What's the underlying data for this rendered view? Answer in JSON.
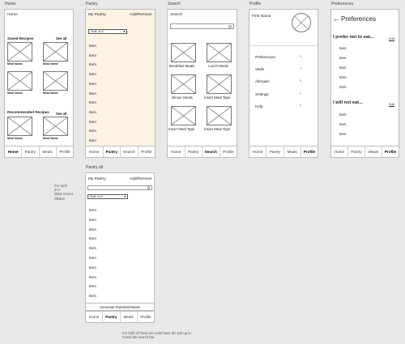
{
  "labels": {
    "home": "Home",
    "pantry": "Pantry",
    "search": "Search",
    "profile": "Profile",
    "preferences": "Preferences",
    "pantry_alt": "Pantry alt"
  },
  "tabs": [
    "Home",
    "Pantry",
    "Search",
    "Profile"
  ],
  "tabs_alt": [
    "Home",
    "Pantry",
    "Meals",
    "Profile"
  ],
  "home": {
    "title": "Home",
    "saved": "Saved Recipes",
    "see_all": "See all",
    "meal_name": "Meal Name",
    "recommended": "Recommended Recipes",
    "see_all_2": "See all"
  },
  "pantry": {
    "title": "My Pantry",
    "action": "Add/Remove",
    "sort": "Sort: A-Z",
    "item": "Item",
    "items_count": 11
  },
  "search": {
    "title": "Search",
    "meals": [
      "Breakfast Meals",
      "Lunch Meals",
      "Dinner Meals",
      "Insert Meal Type",
      "Insert Meal Type",
      "Insert Meal Type"
    ]
  },
  "profile": {
    "name": "First Name",
    "menu": [
      "Preferences",
      "Vedis",
      "Allergies",
      "Settings",
      "Help"
    ]
  },
  "prefs": {
    "title": "Preferences",
    "back": "←",
    "section1": "I prefer not to eat...",
    "section2": "I will not eat...",
    "edit": "Edit",
    "item": "Item"
  },
  "pantry_alt": {
    "title": "My Pantry",
    "action": "Add/Remove",
    "sort": "Sort: A-Z",
    "item": "Item",
    "generate": "Generate Potential Meals"
  },
  "notes": {
    "sort_options": [
      "For sort:",
      "Z-A",
      "Most recent",
      "Oldest"
    ],
    "pull_note": [
      "For both of these we could have the pull up to",
      "reveal the search bar"
    ]
  }
}
